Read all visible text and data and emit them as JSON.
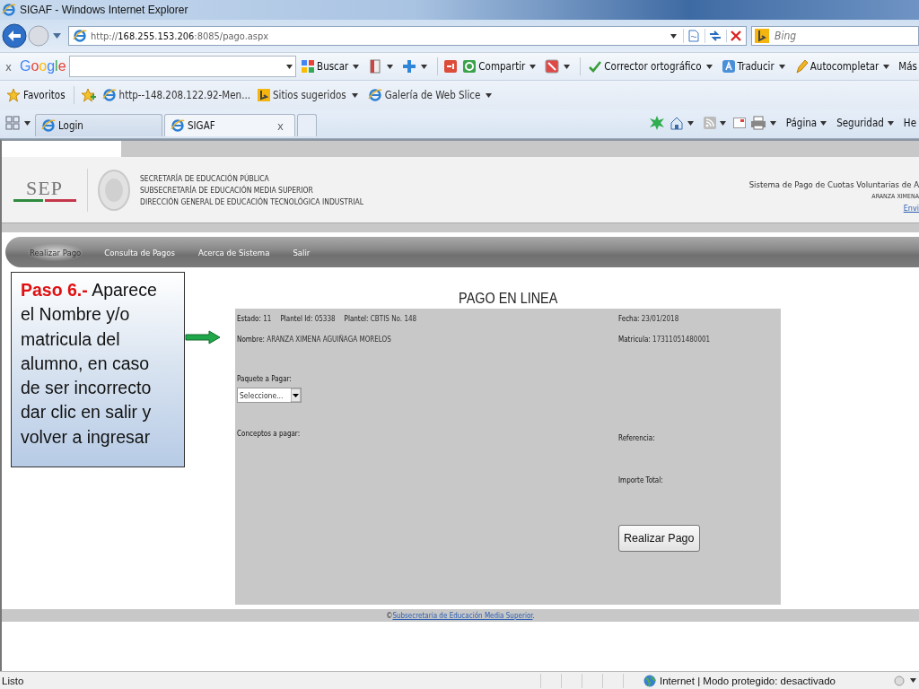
{
  "window": {
    "title": "SIGAF - Windows Internet Explorer"
  },
  "address_bar": {
    "url": "http://**168.255.153.206**:8085/pago.aspx"
  },
  "search_box": {
    "placeholder": "Bing"
  },
  "google_toolbar": {
    "close": "x",
    "logo": "Google",
    "items": [
      {
        "kind": "menu",
        "label": "Buscar"
      },
      {
        "kind": "icon_menu"
      },
      {
        "kind": "icon_menu"
      },
      {
        "kind": "icon"
      },
      {
        "kind": "menu",
        "label": "Compartir"
      },
      {
        "kind": "icon_menu"
      },
      {
        "kind": "menu",
        "label": "Corrector ortográfico"
      },
      {
        "kind": "menu",
        "label": "Traducir"
      },
      {
        "kind": "menu",
        "label": "Autocompletar"
      },
      {
        "kind": "text",
        "label": "Más"
      }
    ]
  },
  "favorites_bar": {
    "label": "Favoritos",
    "items": [
      {
        "label": "http--148.208.122.92-Men...",
        "menu": false
      },
      {
        "label": "Sitios sugeridos",
        "menu": true
      },
      {
        "label": "Galería de Web Slice",
        "menu": true
      }
    ]
  },
  "tabs": [
    {
      "label": "Login",
      "selected": false
    },
    {
      "label": "SIGAF",
      "selected": true,
      "close": "x"
    }
  ],
  "command_bar": {
    "menus": [
      "Página",
      "Seguridad"
    ],
    "cut_item": "He"
  },
  "header": {
    "logo": "SEP",
    "lines": [
      "SECRETARÍA DE EDUCACIÓN PÚBLICA",
      "SUBSECRETARÍA DE EDUCACIÓN MEDIA SUPERIOR",
      "DIRECCIÓN GENERAL DE EDUCACIÓN TECNOLÓGICA INDUSTRIAL"
    ],
    "system_name": "Sistema de Pago de Cuotas Voluntarias de A",
    "user": "ARANZA XIMENA",
    "link": "Envi"
  },
  "nav": [
    {
      "label": "Realizar Pago",
      "selected": true
    },
    {
      "label": "Consulta de Pagos",
      "selected": false
    },
    {
      "label": "Acerca de Sistema",
      "selected": false
    },
    {
      "label": "Salir",
      "selected": false
    }
  ],
  "callout": {
    "text": "**Paso 6.-** Aparece el Nombre y/o matricula del alumno, en caso de ser incorrecto dar clic en salir y volver a ingresar"
  },
  "page_title": "PAGO EN LINEA",
  "form": {
    "left_info": [
      "**Estado:** 11",
      "**Plantel Id:** 05338",
      "**Plantel:** CBTIS No. 148"
    ],
    "fecha": "**Fecha:** 23/01/2018",
    "nombre": "**Nombre:** ARANZA XIMENA AGUIÑAGA MORELOS",
    "matricula": "**Matricula:** 17311051480001",
    "paquete_label": "Paquete a Pagar:",
    "paquete_select": "Seleccione...",
    "conceptos_label": "Conceptos a pagar:",
    "referencia_label": "Referencia:",
    "importe_label": "Importe Total:",
    "submit": "Realizar Pago"
  },
  "footer": {
    "symbol": "©",
    "link": "Subsecretaria de Educación Media Superior",
    "end": "."
  },
  "status_bar": {
    "status": "Listo",
    "zone": "Internet | Modo protegido: desactivado"
  }
}
